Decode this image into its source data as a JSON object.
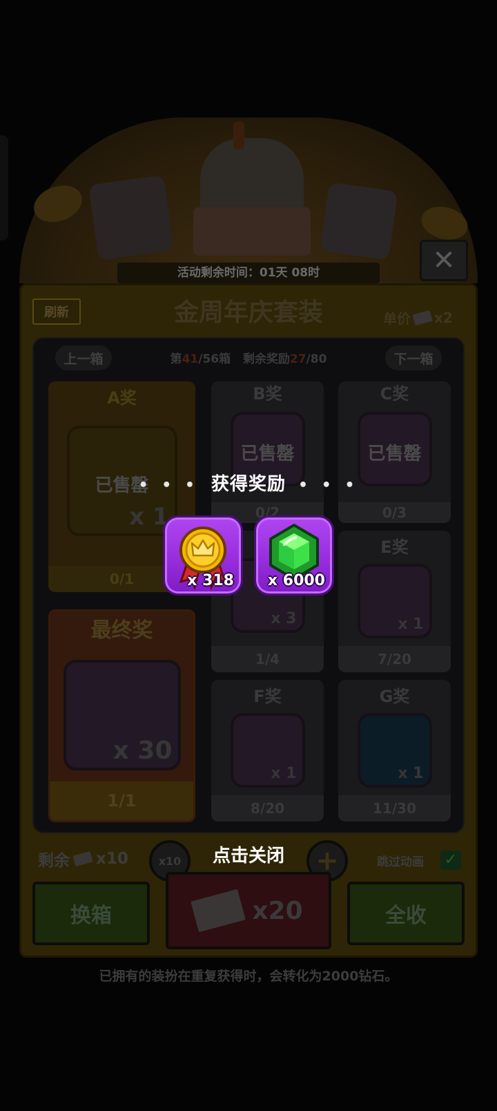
{
  "event": {
    "timer_text": "活动剩余时间：01天 08时"
  },
  "panel": {
    "refresh_label": "刷新",
    "title": "金周年庆套装",
    "price_label": "单价",
    "price_qty": "x2",
    "prev_box": "上一箱",
    "next_box": "下一箱",
    "box_prefix": "第",
    "box_current": "41",
    "box_total": "/56箱",
    "rewards_prefix": "剩余奖励",
    "rewards_current": "27",
    "rewards_total": "/80"
  },
  "prizes": {
    "a": {
      "title": "A奖",
      "status": "已售罄",
      "qty": "x 1",
      "count": "0/1"
    },
    "b": {
      "title": "B奖",
      "status": "已售罄",
      "count": "0/2"
    },
    "c": {
      "title": "C奖",
      "status": "已售罄",
      "count": "0/3"
    },
    "d": {
      "qty": "x 3",
      "count": "1/4"
    },
    "e": {
      "title": "E奖",
      "qty": "x 1",
      "count": "7/20"
    },
    "final": {
      "title": "最终奖",
      "qty": "x 30",
      "count": "1/1"
    },
    "f": {
      "title": "F奖",
      "qty": "x 1",
      "count": "8/20"
    },
    "g": {
      "title": "G奖",
      "qty": "x 1",
      "count": "11/30"
    }
  },
  "controls": {
    "remaining_label": "剩余",
    "remaining_qty": "x10",
    "minus_label": "x10",
    "plus_label": "+",
    "skip_label": "跳过动画",
    "switch_box": "换箱",
    "draw_qty": "x20",
    "collect_all": "全收"
  },
  "note": "已拥有的装扮在重复获得时，会转化为2000钻石。",
  "overlay": {
    "title": "获得奖励",
    "dots": "• • •",
    "items": [
      {
        "icon": "gold-medal-icon",
        "qty": "x 318"
      },
      {
        "icon": "green-gem-icon",
        "qty": "x 6000"
      }
    ],
    "close_hint": "点击关闭"
  },
  "colors": {
    "reward_purple": "#9a2fe0",
    "gem_green": "#2ecc40",
    "medal_gold": "#f5b800",
    "ribbon_red": "#d42a2a"
  }
}
